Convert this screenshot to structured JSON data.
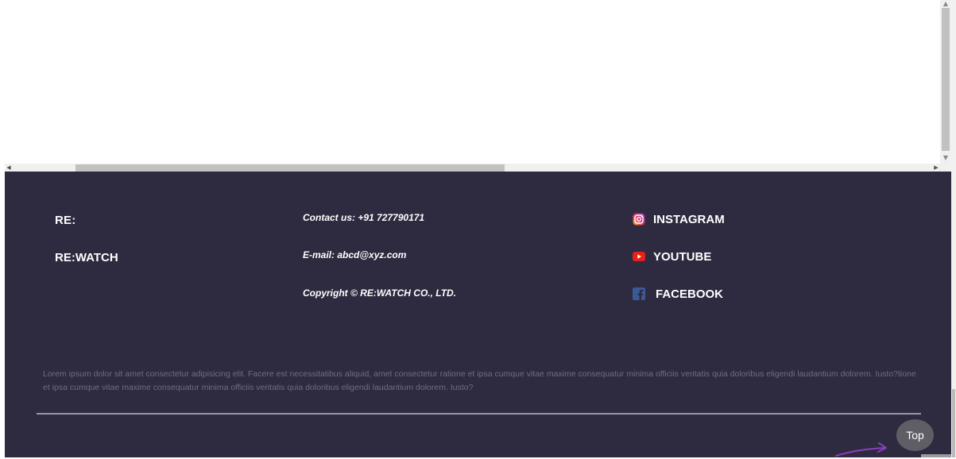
{
  "footer": {
    "brand_short": "RE:",
    "brand_full": "RE:WATCH",
    "contact": "Contact us: +91 727790171",
    "email": "E-mail: abcd@xyz.com",
    "copyright": "Copyright © RE:WATCH CO., LTD.",
    "social": [
      {
        "label": "INSTAGRAM",
        "icon": "instagram-icon",
        "color": "#d4347e"
      },
      {
        "label": "YOUTUBE",
        "icon": "youtube-icon",
        "color": "#e62117"
      },
      {
        "label": "FACEBOOK",
        "icon": "facebook-icon",
        "color": "#3b5998"
      }
    ],
    "description": "Lorem ipsum dolor sit amet consectetur adipisicing elit. Facere est necessitatibus aliquid, amet consectetur ratione et ipsa cumque vitae maxime consequatur minima officiis veritatis quia doloribus eligendi laudantium dolorem. Iusto?tione et ipsa cumque vitae maxime consequatur minima officiis veritatis quia doloribus eligendi laudantium dolorem. Iusto?",
    "top_button": "Top"
  },
  "colors": {
    "footer_bg": "#2e2a40",
    "annotation_arrow": "#8a3fbf"
  }
}
